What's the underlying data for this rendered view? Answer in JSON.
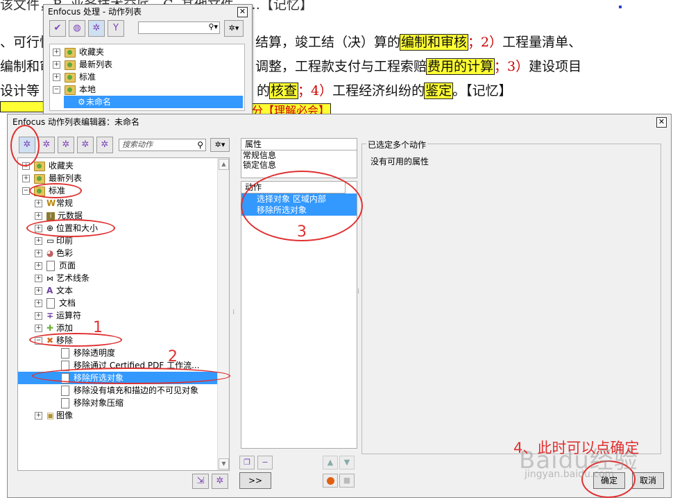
{
  "document": {
    "line0": "该文件，B. 业务技术交底，C. 其他文件……【记忆】",
    "line1_pre": "、可行性",
    "line1_mid": "结算，竣工结（决）算的",
    "line1_hl": "编制和审核",
    "line1_num": "；2）",
    "line1_post": "工程量清单、",
    "line2_pre": "编制和审",
    "line2_mid": "调整，工程款支付与工程索赔",
    "line2_hl": "费用的计算",
    "line2_num": "；3）",
    "line2_post": "建设项目",
    "line3_pre": "设计等",
    "line3_mid": "的",
    "line3_hl": "核查",
    "line3_num": "；4）",
    "line3_post": "工程经济纠纷的",
    "line3_hl2": "鉴定",
    "line3_end": "。【记忆】",
    "line4_hl": "分【理解必会】"
  },
  "small_window": {
    "title": "Enfocus 处理 - 动作列表",
    "close": "✕",
    "tree": [
      {
        "label": "收藏夹",
        "expander": "+"
      },
      {
        "label": "最新列表",
        "expander": "+"
      },
      {
        "label": "标准",
        "expander": "+"
      },
      {
        "label": "本地",
        "expander": "−"
      },
      {
        "label": "未命名",
        "expander": ""
      }
    ]
  },
  "editor": {
    "title": "Enfocus 动作列表编辑器：未命名",
    "close": "✕",
    "search_placeholder": "搜索动作",
    "tree": [
      {
        "label": "收藏夹",
        "expander": "+"
      },
      {
        "label": "最新列表",
        "expander": "+"
      },
      {
        "label": "标准",
        "expander": "−"
      },
      {
        "label": "常规",
        "expander": "+"
      },
      {
        "label": "元数据",
        "expander": "+"
      },
      {
        "label": "位置和大小",
        "expander": "+"
      },
      {
        "label": "印前",
        "expander": "+"
      },
      {
        "label": "色彩",
        "expander": "+"
      },
      {
        "label": "页面",
        "expander": "+"
      },
      {
        "label": "艺术线条",
        "expander": "+"
      },
      {
        "label": "文本",
        "expander": "+"
      },
      {
        "label": "文档",
        "expander": "+"
      },
      {
        "label": "运算符",
        "expander": "+"
      },
      {
        "label": "添加",
        "expander": "+"
      },
      {
        "label": "移除",
        "expander": "−"
      },
      {
        "label": "移除透明度",
        "expander": ""
      },
      {
        "label": "移除通过 Certified PDF 工作流...",
        "expander": ""
      },
      {
        "label": "移除所选对象",
        "expander": ""
      },
      {
        "label": "移除没有填充和描边的不可见对象",
        "expander": ""
      },
      {
        "label": "移除对象压缩",
        "expander": ""
      },
      {
        "label": "图像",
        "expander": "+"
      }
    ],
    "properties_header": "属性",
    "properties": [
      "常规信息",
      "锁定信息"
    ],
    "actions_header": "动作",
    "actions": [
      "选择对象 区域内部",
      "移除所选对象"
    ],
    "right_group_title": "已选定多个动作",
    "right_text": "没有可用的属性",
    "more_button": ">>",
    "ok_button": "确定",
    "cancel_button": "取消"
  },
  "annotations": {
    "n1": "1",
    "n2": "2",
    "n3": "3",
    "n4": "4、此时可以点确定",
    "color": "#e03030"
  },
  "watermark": {
    "main": "Baidu经验",
    "sub": "jingyan.baidu.com"
  }
}
